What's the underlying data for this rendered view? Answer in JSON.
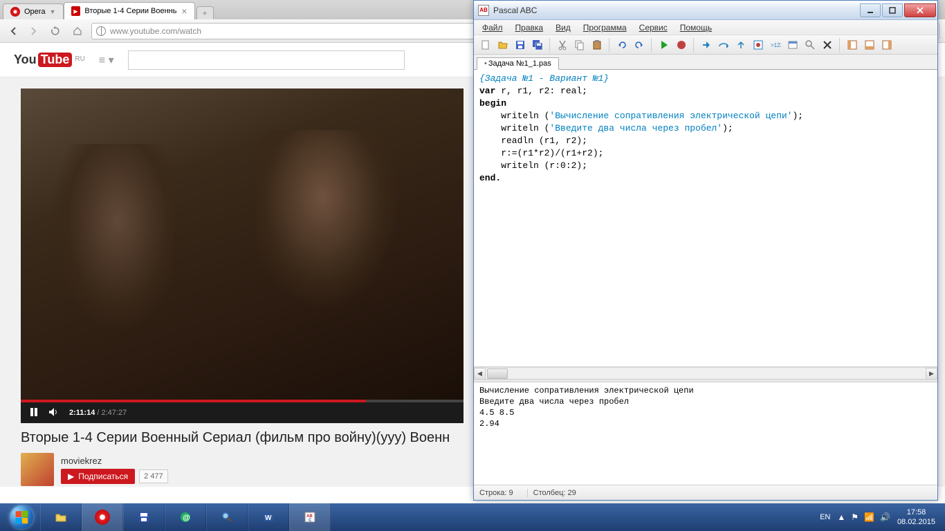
{
  "opera": {
    "label": "Opera",
    "active_tab": "Вторые 1-4 Серии Военны",
    "tab_close": "×",
    "new_tab": "+",
    "url": "www.youtube.com/watch"
  },
  "youtube": {
    "logo_you": "You",
    "logo_tube": "Tube",
    "region": "RU",
    "player": {
      "current_time": "2:11:14",
      "duration": "2:47:27"
    },
    "title": "Вторые 1-4 Серии Военный Сериал (фильм про войну)(ууу) Военн",
    "channel": "moviekrez",
    "subscribe": "Подписаться",
    "sub_count": "2 477"
  },
  "pascal": {
    "title": "Pascal ABC",
    "menu": {
      "file": "Файл",
      "edit": "Правка",
      "view": "Вид",
      "program": "Программа",
      "service": "Сервис",
      "help": "Помощь"
    },
    "tab": "Задача №1_1.pas",
    "code": {
      "comment": "{Задача №1 - Вариант №1}",
      "var_line_pre": "var",
      "var_line_post": " r, r1, r2: real;",
      "begin": "begin",
      "w1_pre": "    writeln (",
      "w1_str": "'Вычисление сопративления электрической цепи'",
      "w1_post": ");",
      "w2_pre": "    writeln (",
      "w2_str": "'Введите два числа через пробел'",
      "w2_post": ");",
      "readln": "    readln (r1, r2);",
      "calc": "    r:=(r1*r2)/(r1+r2);",
      "w3": "    writeln (r:0:2);",
      "end": "end."
    },
    "output": "Вычисление сопративления электрической цепи\nВведите два числа через пробел\n4.5 8.5\n2.94",
    "status": {
      "line": "Строка: 9",
      "col": "Столбец: 29"
    }
  },
  "taskbar": {
    "lang": "EN",
    "time": "17:58",
    "date": "08.02.2015"
  }
}
